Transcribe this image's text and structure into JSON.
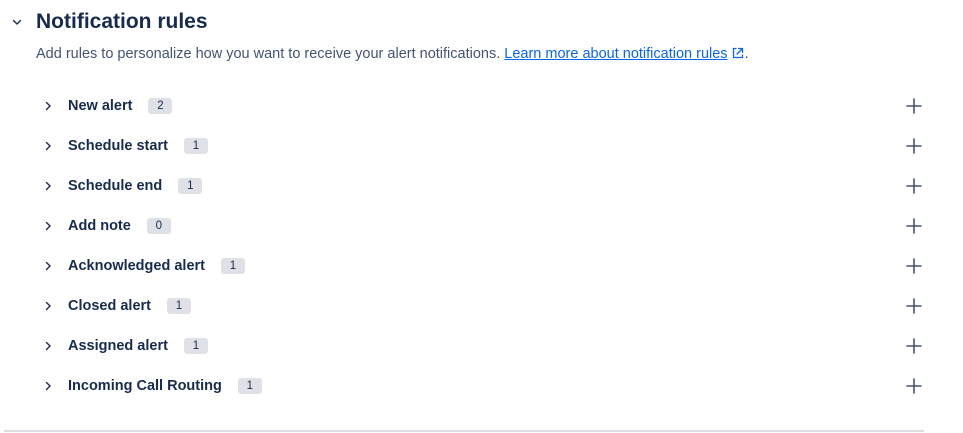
{
  "section": {
    "title": "Notification rules",
    "description": "Add rules to personalize how you want to receive your alert notifications.",
    "link_text": "Learn more about notification rules",
    "trailing_period": "."
  },
  "rules": [
    {
      "label": "New alert",
      "count": "2"
    },
    {
      "label": "Schedule start",
      "count": "1"
    },
    {
      "label": "Schedule end",
      "count": "1"
    },
    {
      "label": "Add note",
      "count": "0"
    },
    {
      "label": "Acknowledged alert",
      "count": "1"
    },
    {
      "label": "Closed alert",
      "count": "1"
    },
    {
      "label": "Assigned alert",
      "count": "1"
    },
    {
      "label": "Incoming Call Routing",
      "count": "1"
    }
  ],
  "icons": {
    "collapse": "chevron-down-icon",
    "expand": "chevron-right-icon",
    "add": "plus-icon",
    "external": "external-link-icon"
  },
  "colors": {
    "text": "#172b4d",
    "subtle_text": "#44546f",
    "link": "#0c66e4",
    "badge_bg": "#dfe1e6",
    "divider": "#dcdfe4"
  }
}
